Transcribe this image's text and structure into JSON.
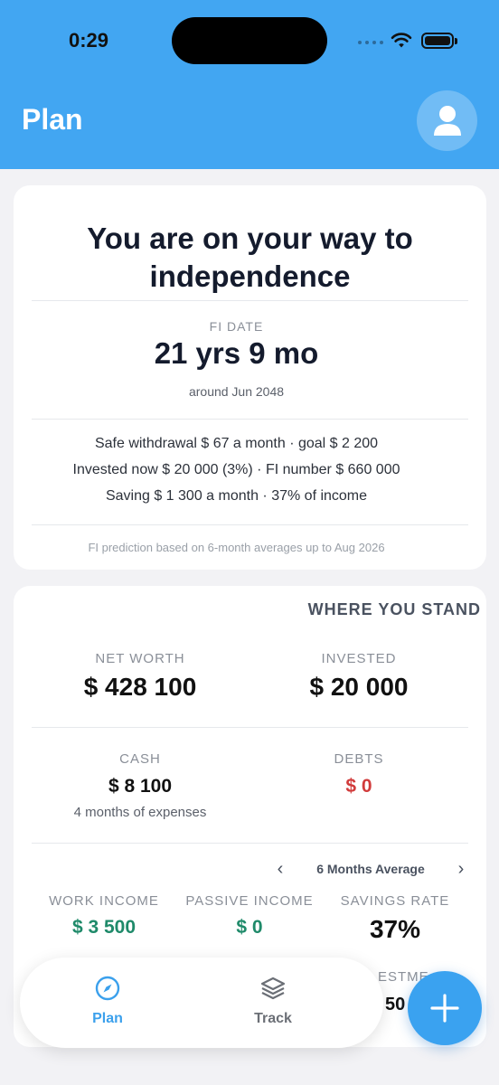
{
  "status_bar": {
    "time": "0:29"
  },
  "header": {
    "title": "Plan"
  },
  "fi_card": {
    "headline": "You are on your way to independence",
    "fi_date_label": "FI DATE",
    "fi_value": "21 yrs 9 mo",
    "fi_sub": "around Jun 2048",
    "details": [
      "Safe withdrawal $ 67 a month · goal $ 2 200",
      "Invested now $ 20 000 (3%) · FI number $ 660 000",
      "Saving $ 1 300 a month · 37% of income"
    ],
    "footnote": "FI prediction based on 6-month averages up to Aug 2026"
  },
  "stand_card": {
    "heading": "WHERE YOU STAND",
    "net_worth": {
      "label": "NET WORTH",
      "value": "$ 428 100"
    },
    "invested": {
      "label": "INVESTED",
      "value": "$ 20 000"
    },
    "cash": {
      "label": "CASH",
      "value": "$ 8 100",
      "sub": "4 months of expenses"
    },
    "debts": {
      "label": "DEBTS",
      "value": "$ 0"
    },
    "period": "6 Months Average",
    "work_income": {
      "label": "WORK INCOME",
      "value": "$ 3 500"
    },
    "passive_income": {
      "label": "PASSIVE INCOME",
      "value": "$ 0"
    },
    "savings_rate": {
      "label": "SAVINGS RATE",
      "value": "37%"
    },
    "peek": {
      "label": "ESTME",
      "value": "50"
    }
  },
  "nav": {
    "plan": {
      "label": "Plan",
      "icon": "compass-icon"
    },
    "track": {
      "label": "Track",
      "icon": "layers-icon"
    }
  },
  "colors": {
    "accent": "#42a6f2",
    "positive": "#1f8a6a",
    "negative": "#d13b3b"
  }
}
